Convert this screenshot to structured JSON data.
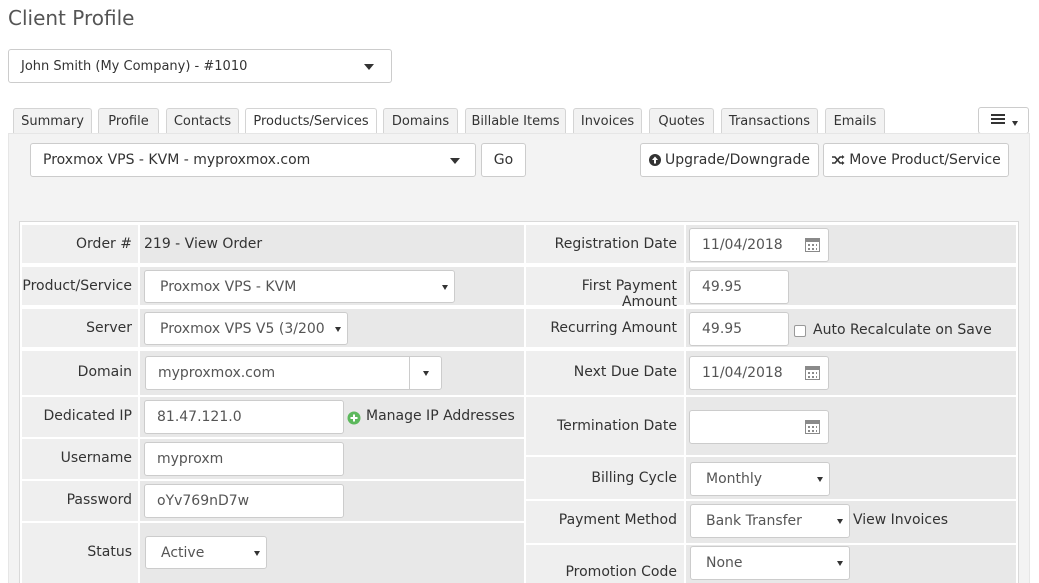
{
  "page": {
    "title": "Client Profile"
  },
  "client_selector": {
    "value": "John Smith (My Company) - #1010"
  },
  "tabs": [
    {
      "label": "Summary"
    },
    {
      "label": "Profile"
    },
    {
      "label": "Contacts"
    },
    {
      "label": "Products/Services",
      "active": true
    },
    {
      "label": "Domains"
    },
    {
      "label": "Billable Items"
    },
    {
      "label": "Invoices"
    },
    {
      "label": "Quotes"
    },
    {
      "label": "Transactions"
    },
    {
      "label": "Emails"
    }
  ],
  "toolbar": {
    "product_select": "Proxmox VPS - KVM - myproxmox.com",
    "go_label": "Go",
    "upgrade_label": "Upgrade/Downgrade",
    "move_label": "Move Product/Service"
  },
  "form": {
    "order_label": "Order #",
    "order_value": "219 - View Order",
    "product_label": "Product/Service",
    "product_value": "Proxmox VPS - KVM",
    "server_label": "Server",
    "server_value": "Proxmox VPS V5 (3/200",
    "domain_label": "Domain",
    "domain_value": "myproxmox.com",
    "ip_label": "Dedicated IP",
    "ip_value": "81.47.121.0",
    "manage_ip_label": "Manage IP Addresses",
    "username_label": "Username",
    "username_value": "myproxm",
    "password_label": "Password",
    "password_value": "oYv769nD7w",
    "status_label": "Status",
    "status_value": "Active",
    "reg_date_label": "Registration Date",
    "reg_date_value": "11/04/2018",
    "first_payment_label": "First Payment Amount",
    "first_payment_value": "49.95",
    "recurring_label": "Recurring Amount",
    "recurring_value": "49.95",
    "auto_recalc_label": "Auto Recalculate on Save",
    "next_due_label": "Next Due Date",
    "next_due_value": "11/04/2018",
    "termination_label": "Termination Date",
    "termination_value": "",
    "billing_cycle_label": "Billing Cycle",
    "billing_cycle_value": "Monthly",
    "payment_method_label": "Payment Method",
    "payment_method_value": "Bank Transfer",
    "view_invoices_label": "View Invoices",
    "promo_label": "Promotion Code",
    "promo_value": "None"
  },
  "icons": {
    "upgrade": "arrow-up-circle-icon",
    "move": "shuffle-icon",
    "manage_ip": "plus-circle-icon",
    "calendar": "calendar-icon",
    "menu": "hamburger-menu-icon"
  },
  "colors": {
    "add_green": "#5cb85c"
  }
}
